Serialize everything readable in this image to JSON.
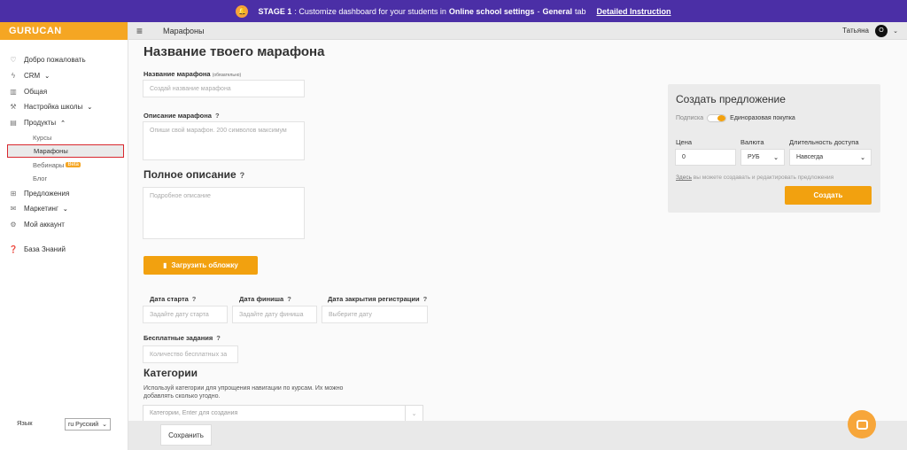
{
  "banner": {
    "stage": "STAGE 1",
    "text_a": ": Customize dashboard for your students in",
    "bold_b": "Online school settings",
    "sep": " - ",
    "bold_c": "General",
    "text_d": " tab",
    "link": "Detailed Instruction"
  },
  "logo": "GURUCAN",
  "sidebar": {
    "items": [
      {
        "label": "Добро пожаловать",
        "icon": "heart-icon"
      },
      {
        "label": "CRM",
        "icon": "bolt-icon",
        "chevron": "down"
      },
      {
        "label": "Общая",
        "icon": "chart-icon"
      },
      {
        "label": "Настройка школы",
        "icon": "wrench-icon",
        "chevron": "down"
      },
      {
        "label": "Продукты",
        "icon": "document-icon",
        "chevron": "up"
      }
    ],
    "sub_items": [
      "Курсы",
      "Марафоны",
      "Вебинары",
      "Блог"
    ],
    "beta_badge": "Beta",
    "items2": [
      {
        "label": "Предложения",
        "icon": "grid-icon"
      },
      {
        "label": "Маркетинг",
        "icon": "mail-icon",
        "chevron": "down"
      },
      {
        "label": "Мой аккаунт",
        "icon": "gear-icon"
      }
    ],
    "knowledge": "База Знаний",
    "language_label": "Язык",
    "language_value": "ru Русский"
  },
  "header": {
    "section": "Марафоны",
    "user_name": "Татьяна",
    "avatar_letter": "О"
  },
  "form": {
    "title": "Название твоего марафона",
    "name_label": "Название марафона",
    "name_required": "(обязательно)",
    "name_placeholder": "Создай название марафона",
    "desc_label": "Описание марафона",
    "desc_placeholder": "Опиши свой марафон. 200 символов максимум",
    "full_title": "Полное описание",
    "full_placeholder": "Подробное описание",
    "upload_btn": "Загрузить обложку",
    "start_label": "Дата старта",
    "start_placeholder": "Задайте дату старта",
    "finish_label": "Дата финиша",
    "finish_placeholder": "Задайте дату финиша",
    "close_label": "Дата закрытия регистрации",
    "close_placeholder": "Выберите дату",
    "free_label": "Бесплатные задания",
    "free_placeholder": "Количество бесплатных за",
    "cat_title": "Категории",
    "cat_desc": "Используй категории для упрощения навигации по курсам. Их можно добавлять сколько угодно.",
    "cat_placeholder": "Категории, Enter для создания",
    "help": "?"
  },
  "offer": {
    "title": "Создать предложение",
    "sub_option": "Подписка",
    "one_time": "Единоразовая покупка",
    "price_label": "Цена",
    "price_value": "0",
    "currency_label": "Валюта",
    "currency_value": "РУБ",
    "access_label": "Длительность доступа",
    "access_value": "Навсегда",
    "note_link": "Здесь",
    "note_rest": " вы можете создавать и редактировать предложения",
    "create_btn": "Создать"
  },
  "bottom": {
    "save": "Сохранить"
  },
  "colors": {
    "accent": "#f2a10f",
    "banner": "#4b2fa6",
    "active_border": "#d9272e"
  }
}
